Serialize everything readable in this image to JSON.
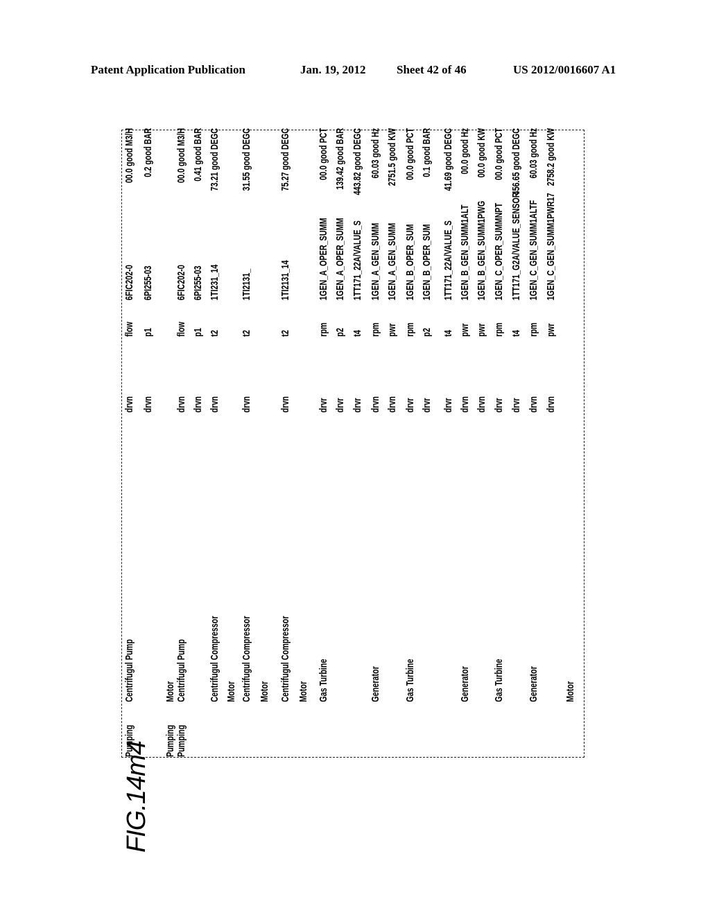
{
  "header": {
    "publication": "Patent Application Publication",
    "date": "Jan. 19, 2012",
    "sheet": "Sheet 42 of 46",
    "number": "US 2012/0016607 A1"
  },
  "figure_label": "FIG.14m4",
  "rows": [
    {
      "c1": "Pumping",
      "c2": "Centrifugul Pump",
      "c3": "drvn",
      "c4": "flow",
      "c5": "6FIC202-0",
      "value": "00.0 good M3/H"
    },
    {
      "c1": "",
      "c2": "",
      "c3": "drvn",
      "c4": "p1",
      "c5": "6PI255-03",
      "value": "0.2 good BAR"
    },
    {
      "c1": "Pumping",
      "c2": "Motor",
      "c3": "",
      "c4": "",
      "c5": "",
      "value": ""
    },
    {
      "c1": "Pumping",
      "c2": "Centrifugul Pump",
      "c3": "drvn",
      "c4": "flow",
      "c5": "6FIC202-0",
      "value": "00.0 good M3/H"
    },
    {
      "c1": "",
      "c2": "",
      "c3": "drvn",
      "c4": "p1",
      "c5": "6PI255-03",
      "value": "0.41 good BAR"
    },
    {
      "c1": "",
      "c2": "Centrifugul Compressor",
      "c3": "drvn",
      "c4": "t2",
      "c5": "1TI231_14",
      "value": "73.21 good DEGC"
    },
    {
      "c1": "",
      "c2": "Motor",
      "c3": "",
      "c4": "",
      "c5": "",
      "value": ""
    },
    {
      "c1": "",
      "c2": "Centrifugul Compressor",
      "c3": "drvn",
      "c4": "t2",
      "c5": "1TI2131_",
      "value": "31.55 good DEGC"
    },
    {
      "c1": "",
      "c2": "Motor",
      "c3": "",
      "c4": "",
      "c5": "",
      "value": ""
    },
    {
      "c1": "",
      "c2": "Centrifugul Compressor",
      "c3": "drvn",
      "c4": "t2",
      "c5": "1TI2131_14",
      "value": "75.27 good DEGC"
    },
    {
      "c1": "",
      "c2": "Motor",
      "c3": "",
      "c4": "",
      "c5": "",
      "value": ""
    },
    {
      "c1": "",
      "c2": "Gas Turbine",
      "c3": "drvr",
      "c4": "rpm",
      "c5": "1GEN_A_OPER_SUMM",
      "value": "00.0 good PCT"
    },
    {
      "c1": "",
      "c2": "",
      "c3": "drvr",
      "c4": "p2",
      "c5": "1GEN_A_OPER_SUMM",
      "value": "139.42 good BAR"
    },
    {
      "c1": "",
      "c2": "",
      "c3": "drvr",
      "c4": "t4",
      "c5": "1TT171_22A/VALUE_S",
      "value": "443.82 good DEGC"
    },
    {
      "c1": "",
      "c2": "Generator",
      "c3": "drvn",
      "c4": "rpm",
      "c5": "1GEN_A_GEN_SUMM",
      "value": "60.03 good Hz"
    },
    {
      "c1": "",
      "c2": "",
      "c3": "drvn",
      "c4": "pwr",
      "c5": "1GEN_A_GEN_SUMM",
      "value": "2751.5 good KW"
    },
    {
      "c1": "",
      "c2": "Gas Turbine",
      "c3": "drvr",
      "c4": "rpm",
      "c5": "1GEN_B_OPER_SUM",
      "value": "00.0 good PCT"
    },
    {
      "c1": "",
      "c2": "",
      "c3": "drvr",
      "c4": "p2",
      "c5": "1GEN_B_OPER_SUM",
      "value": "0.1 good BAR"
    },
    {
      "c1": "",
      "c2": "",
      "c3": "drvr",
      "c4": "t4",
      "c5": "1TT171_22A/VALUE_S",
      "value": "41.69 good DEGC"
    },
    {
      "c1": "",
      "c2": "Generator",
      "c3": "drvn",
      "c4": "pwr",
      "c5": "1GEN_B_GEN_SUMM1ALT",
      "value": "00.0 good Hz"
    },
    {
      "c1": "",
      "c2": "",
      "c3": "drvn",
      "c4": "pwr",
      "c5": "1GEN_B_GEN_SUMM1PWG",
      "value": "00.0 good KW"
    },
    {
      "c1": "",
      "c2": "Gas Turbine",
      "c3": "drvr",
      "c4": "rpm",
      "c5": "1GEN_C_OPER_SUMMNPT",
      "value": "00.0 good PCT"
    },
    {
      "c1": "",
      "c2": "",
      "c3": "drvr",
      "c4": "t4",
      "c5": "1TT171_G2A/VALUE_SENSOR",
      "value": "456.65 good DEGC"
    },
    {
      "c1": "",
      "c2": "Generator",
      "c3": "drvn",
      "c4": "rpm",
      "c5": "1GEN_C_GEN_SUMM1ALTF",
      "value": "60.03 good Hz"
    },
    {
      "c1": "",
      "c2": "",
      "c3": "drvn",
      "c4": "pwr",
      "c5": "1GEN_C_GEN_SUMM1PWR17",
      "value": "2758.2 good KW"
    },
    {
      "c1": "",
      "c2": "Motor",
      "c3": "",
      "c4": "",
      "c5": "",
      "value": ""
    }
  ]
}
